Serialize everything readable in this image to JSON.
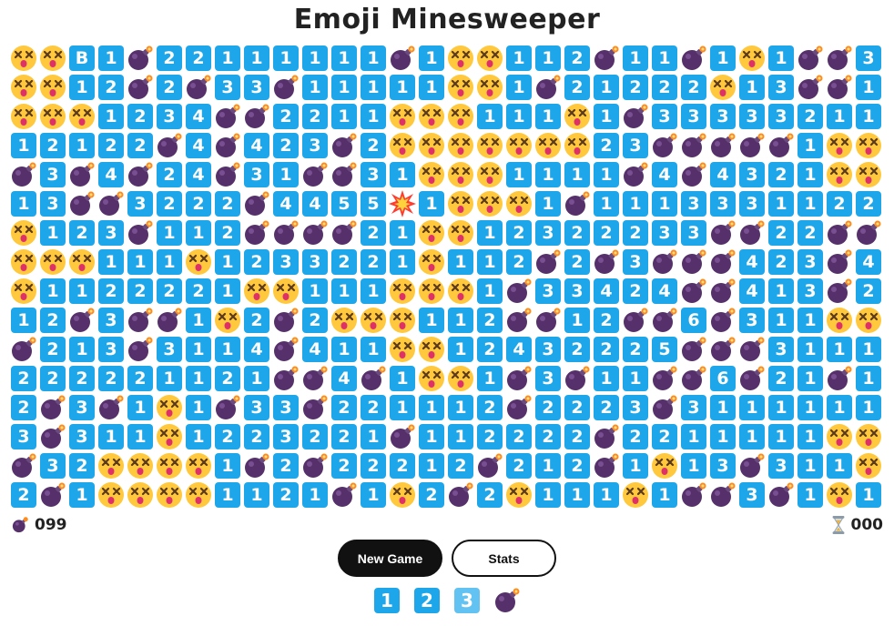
{
  "title": "Emoji Minesweeper",
  "board": {
    "rows": 16,
    "cols": 30,
    "grid": [
      "XXB1M22111111M1XX112M11M1X1MM31",
      "XX12M2M33M11111XX1M21222X13MM1",
      "XXX1234MM2211XXX111X1M333332 1",
      "12122M4M423M2XXXXXXX23MMMMM1XX",
      "M3M4M24M31MM31XXX1111M4M4321XX",
      "13MM3222M4455*1XXX1M11133311221",
      "X123M112MMMM21XX12322233MM22MM1",
      "XXX111X1233221X112M2M3MMM423M421",
      "X1122221XX111XXX1M33424MM413M2XX",
      "12M3MM1X2M2XXX112MM12MM6M311XX",
      "M213M3114M411XX12432225MMM3111X",
      "222221121MM4M1XX1M3M11MM6M21M1X",
      "2M3M1X1M33M221112M2223M31111111X",
      "3M311X1223221M112222M2211111XXX",
      "M32XXXX1M2M22212M212M1X13M311X",
      "2M1XXXX1121M1X2M2X111X1MM3M1X"
    ],
    "legend_codes": {
      "1": "number 1",
      "2": "number 2",
      "3": "number 3",
      "4": "number 4",
      "5": "number 5",
      "6": "number 6",
      "M": "bomb",
      "X": "dizzy-face",
      "*": "exploded-mine"
    }
  },
  "counters": {
    "mines_label": "099",
    "mines_icon": "bomb-icon",
    "timer_label": "000",
    "timer_icon": "hourglass-icon"
  },
  "buttons": {
    "new_game": "New Game",
    "stats": "Stats"
  },
  "legend": [
    {
      "label": "1",
      "style": "tile"
    },
    {
      "label": "2",
      "style": "tile"
    },
    {
      "label": "3",
      "style": "faded-tile"
    },
    {
      "label": "",
      "style": "bomb"
    }
  ],
  "colors": {
    "tile": "#1ea6ea",
    "tile_faded": "#62c2f2",
    "bomb": "#55306a",
    "bomb_fuse": "#ff8c1a",
    "face": "#ffc83d",
    "face_mouth": "#e0306a",
    "button_dark": "#111111"
  }
}
